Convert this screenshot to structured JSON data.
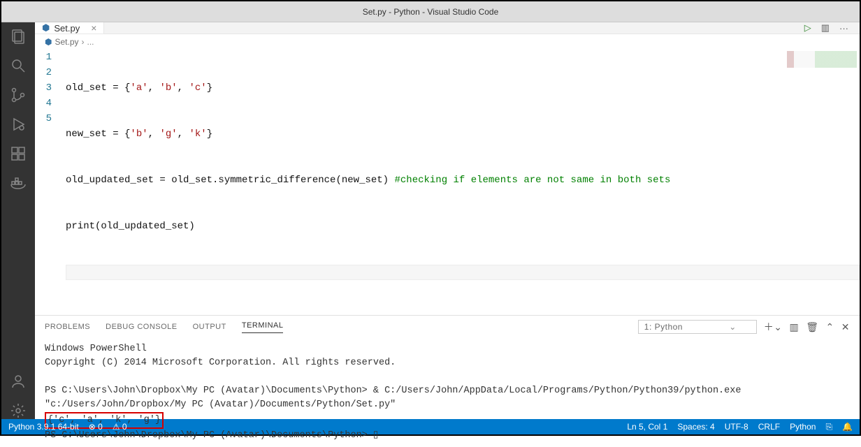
{
  "window": {
    "title": "Set.py - Python - Visual Studio Code"
  },
  "tab": {
    "filename": "Set.py"
  },
  "breadcrumb": {
    "filename": "Set.py",
    "sep": "›",
    "more": "..."
  },
  "code": {
    "ln1_a": "old_set = {",
    "ln1_s1": "'a'",
    "ln1_c1": ", ",
    "ln1_s2": "'b'",
    "ln1_c2": ", ",
    "ln1_s3": "'c'",
    "ln1_e": "}",
    "ln2_a": "new_set = {",
    "ln2_s1": "'b'",
    "ln2_c1": ", ",
    "ln2_s2": "'g'",
    "ln2_c2": ", ",
    "ln2_s3": "'k'",
    "ln2_e": "}",
    "ln3_a": "old_updated_set = old_set.symmetric_difference(new_set) ",
    "ln3_cmt": "#checking if elements are not same in both sets",
    "ln4": "print(old_updated_set)",
    "ln5": "",
    "nums": {
      "n1": "1",
      "n2": "2",
      "n3": "3",
      "n4": "4",
      "n5": "5"
    }
  },
  "panel": {
    "tabs": {
      "problems": "PROBLEMS",
      "debug": "DEBUG CONSOLE",
      "output": "OUTPUT",
      "terminal": "TERMINAL"
    },
    "terminal_select": "1: Python",
    "chev": "⌄"
  },
  "terminal": {
    "l1": "Windows PowerShell",
    "l2": "Copyright (C) 2014 Microsoft Corporation. All rights reserved.",
    "l3a": "PS C:\\Users\\John\\Dropbox\\My PC (Avatar)\\Documents\\Python> & C:/Users/John/AppData/Local/Programs/Python/Python39/python.exe",
    "l3b": "\"c:/Users/John/Dropbox/My PC (Avatar)/Documents/Python/Set.py\"",
    "out": "{'c', 'a', 'k', 'g'}",
    "l5": "PS C:\\Users\\John\\Dropbox\\My PC (Avatar)\\Documents\\Python> ",
    "cursor": "▯"
  },
  "status": {
    "python": "Python 3.9.1 64-bit",
    "err": "⊗ 0",
    "warn": "⚠ 0",
    "lncol": "Ln 5, Col 1",
    "spaces": "Spaces: 4",
    "enc": "UTF-8",
    "eol": "CRLF",
    "lang": "Python",
    "feedback": "⎘",
    "bell": "🔔"
  },
  "icons": {
    "run": "▷",
    "split": "▥",
    "more": "···",
    "plus": "＋⌄",
    "splitterm": "▥",
    "trash": "🗑",
    "up": "⌃",
    "close": "✕"
  }
}
